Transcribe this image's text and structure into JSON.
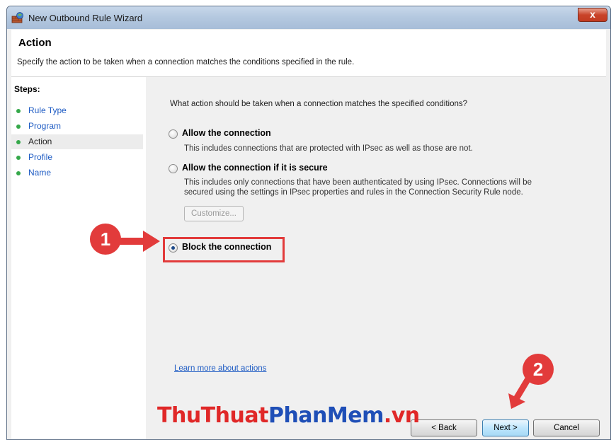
{
  "window": {
    "title": "New Outbound Rule Wizard",
    "close_label": "x"
  },
  "header": {
    "title": "Action",
    "description": "Specify the action to be taken when a connection matches the conditions specified in the rule."
  },
  "steps": {
    "title": "Steps:",
    "items": [
      {
        "label": "Rule Type"
      },
      {
        "label": "Program"
      },
      {
        "label": "Action"
      },
      {
        "label": "Profile"
      },
      {
        "label": "Name"
      }
    ],
    "active_index": 2
  },
  "content": {
    "question": "What action should be taken when a connection matches the specified conditions?",
    "options": [
      {
        "label": "Allow the connection",
        "description": [
          "This includes connections that are protected with IPsec as well as those are not."
        ],
        "selected": false
      },
      {
        "label": "Allow the connection if it is secure",
        "description": [
          "This includes only connections that have been authenticated by using IPsec.  Connections will be",
          "secured using the settings in IPsec properties and rules in the Connection Security Rule node."
        ],
        "selected": false
      },
      {
        "label": "Block the connection",
        "description": [],
        "selected": true
      }
    ],
    "customize_label": "Customize...",
    "learn_more": "Learn more about actions"
  },
  "buttons": {
    "back": "< Back",
    "next": "Next >",
    "cancel": "Cancel"
  },
  "annotations": {
    "badge1": "1",
    "badge2": "2",
    "accent_color": "#e23b3b"
  },
  "watermark": {
    "part1": "ThuThuat",
    "part2": "PhanMem",
    "part3": ".vn"
  }
}
